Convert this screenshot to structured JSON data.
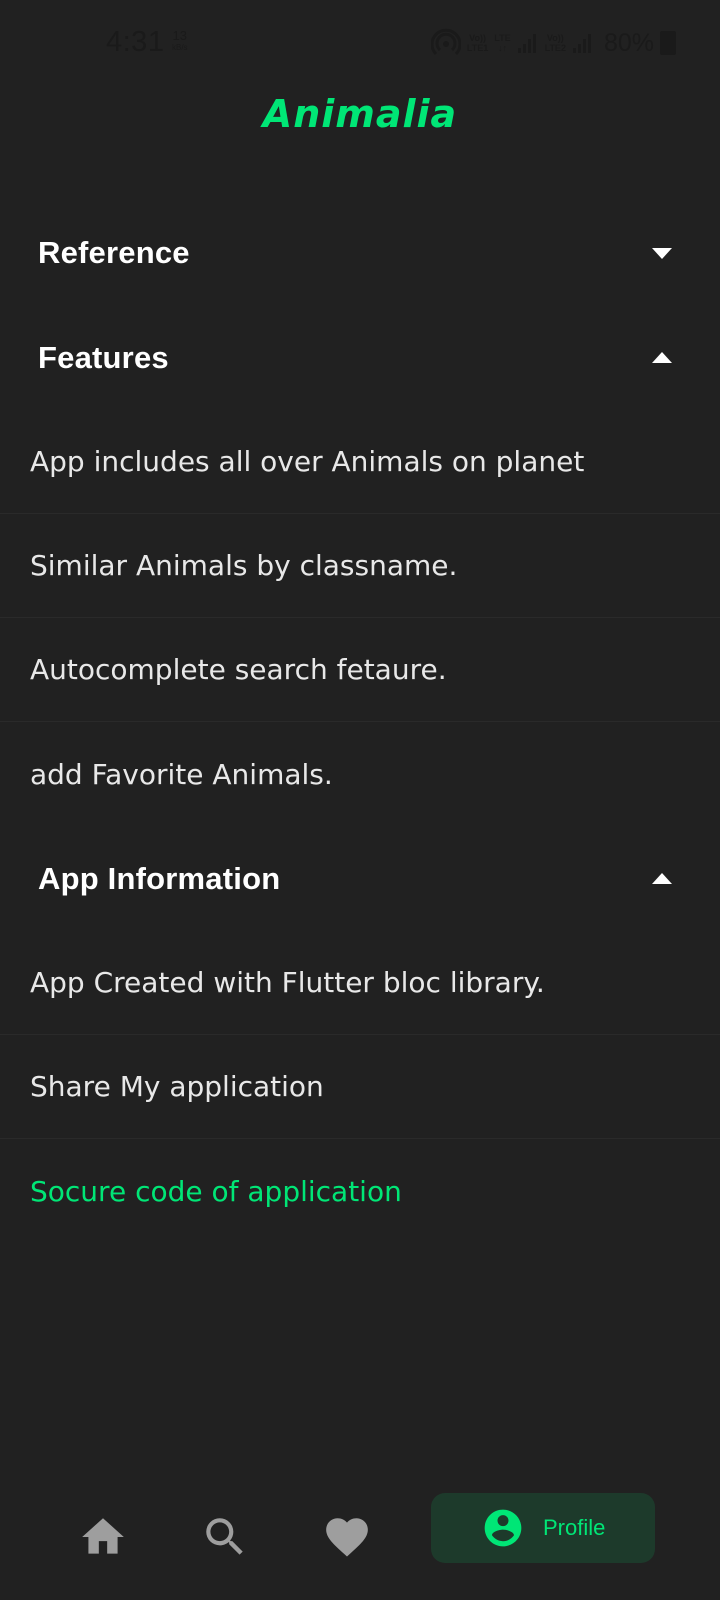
{
  "status_bar": {
    "time": "4:31",
    "speed_value": "13",
    "speed_unit": "kB/s",
    "sim1_top": "Vo))",
    "sim1_bottom": "LTE1",
    "lte_top": "LTE",
    "lte_bottom": "↓↑",
    "sim2_top": "Vo))",
    "sim2_bottom": "LTE2",
    "battery": "80%"
  },
  "app": {
    "title": "Animalia"
  },
  "sections": {
    "reference": {
      "label": "Reference",
      "state": "collapsed"
    },
    "features": {
      "label": "Features",
      "state": "expanded",
      "items": [
        "App includes all over Animals on planet",
        "Similar Animals by classname.",
        "Autocomplete search fetaure.",
        "add Favorite Animals."
      ]
    },
    "app_info": {
      "label": "App Information",
      "state": "expanded",
      "items": [
        "App Created with Flutter bloc library.",
        "Share My application",
        "Socure code of application"
      ]
    }
  },
  "bottom_nav": {
    "items": [
      {
        "icon": "home-icon"
      },
      {
        "icon": "search-icon"
      },
      {
        "icon": "heart-icon"
      },
      {
        "icon": "profile-icon",
        "label": "Profile",
        "active": true
      }
    ]
  },
  "colors": {
    "background": "#212121",
    "accent": "#00e676",
    "active_nav_bg": "#1d3a2b",
    "nav_icon": "#9e9e9e"
  }
}
